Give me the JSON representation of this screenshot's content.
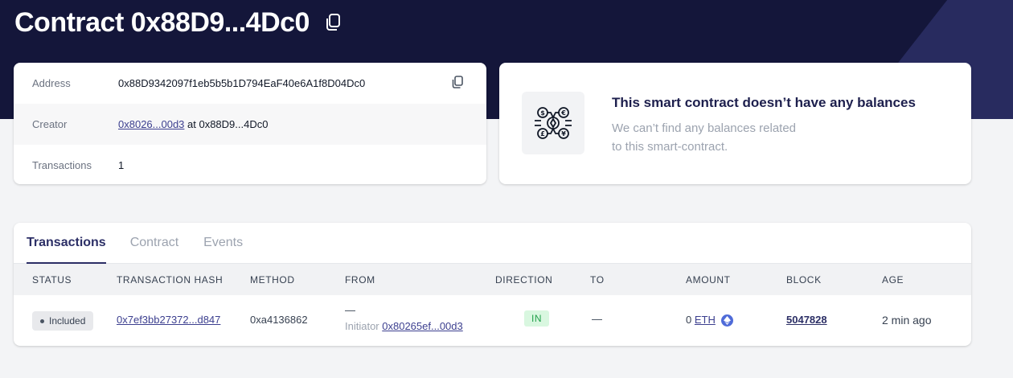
{
  "header": {
    "title": "Contract 0x88D9...4Dc0",
    "copy_icon": "copy-icon"
  },
  "info": {
    "rows": [
      {
        "label": "Address",
        "value": "0x88D9342097f1eb5b5b1D794EaF40e6A1f8D04Dc0"
      },
      {
        "label": "Creator",
        "link": "0x8026...00d3",
        "suffix": " at 0x88D9...4Dc0"
      },
      {
        "label": "Transactions",
        "value": "1"
      }
    ]
  },
  "balances": {
    "icon": "currency-network-icon",
    "title": "This smart contract doesn’t have any balances",
    "desc_line1": "We can’t find any balances related",
    "desc_line2": "to this smart-contract."
  },
  "tabs": [
    {
      "label": "Transactions",
      "active": true
    },
    {
      "label": "Contract",
      "active": false
    },
    {
      "label": "Events",
      "active": false
    }
  ],
  "table": {
    "headers": {
      "status": "STATUS",
      "hash": "TRANSACTION HASH",
      "method": "METHOD",
      "from": "FROM",
      "direction": "DIRECTION",
      "to": "TO",
      "amount": "AMOUNT",
      "block": "BLOCK",
      "age": "AGE"
    },
    "rows": [
      {
        "status": "Included",
        "hash": "0x7ef3bb27372...d847",
        "method": "0xa4136862",
        "from": "—",
        "initiator_label": "Initiator",
        "initiator": "0x80265ef...00d3",
        "direction": "IN",
        "to": "—",
        "amount_value": "0",
        "amount_unit": "ETH",
        "block": "5047828",
        "age": "2 min ago"
      }
    ]
  },
  "colors": {
    "hero_bg": "#14163a",
    "accent": "#2c2f66",
    "link": "#3c3f8f",
    "in_badge_bg": "#d9f7e0",
    "in_badge_text": "#22a04b"
  }
}
